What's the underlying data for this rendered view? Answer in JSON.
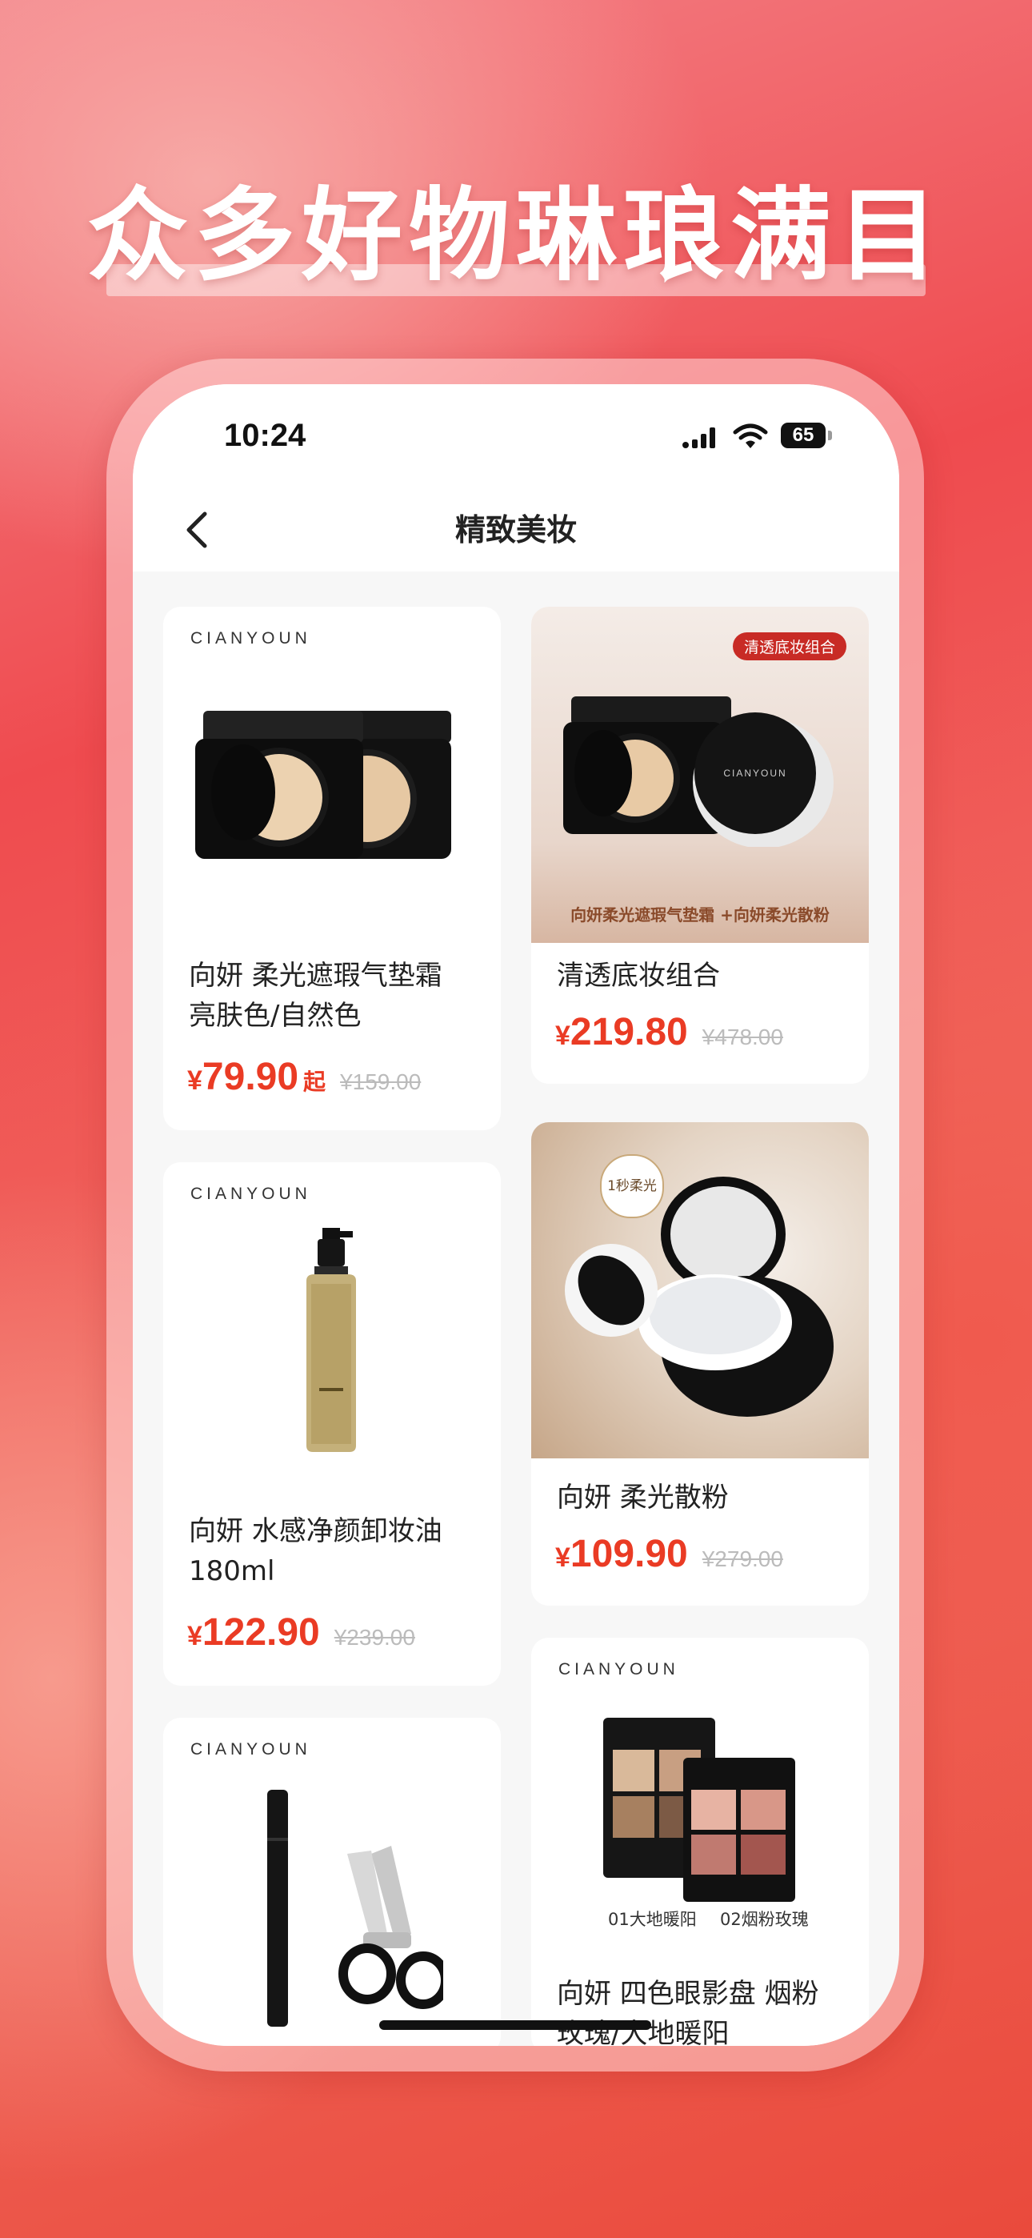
{
  "headline": "众多好物琳琅满目",
  "status_bar": {
    "time": "10:24",
    "battery": "65"
  },
  "nav": {
    "title": "精致美妆"
  },
  "products": [
    {
      "brand": "CIANYOUN",
      "title_line1": "向妍 柔光遮瑕气垫霜",
      "title_line2": "亮肤色/自然色",
      "price": "79.90",
      "price_suffix": "起",
      "original_price": "¥159.00"
    },
    {
      "tag": "清透底妆组合",
      "caption": "向妍柔光遮瑕气垫霜 +向妍柔光散粉",
      "title_line1": "清透底妆组合",
      "price": "219.80",
      "original_price": "¥478.00"
    },
    {
      "brand": "CIANYOUN",
      "title_line1": "向妍 水感净颜卸妆油",
      "title_line2": "180ml",
      "price": "122.90",
      "original_price": "¥239.00"
    },
    {
      "badge": "1秒柔光",
      "title_line1": "向妍 柔光散粉",
      "price": "109.90",
      "original_price": "¥279.00"
    },
    {
      "brand": "CIANYOUN"
    },
    {
      "brand": "CIANYOUN",
      "swatch_1": "01大地暖阳",
      "swatch_2": "02烟粉玫瑰",
      "title_line1": "向妍 四色眼影盘 烟粉",
      "title_line2": "玫瑰/大地暖阳"
    }
  ],
  "currency": "¥",
  "colors": {
    "accent": "#ea3b24",
    "tag": "#c82b25"
  },
  "icons": {
    "back": "chevron-left-icon",
    "signal": "cellular-signal-icon",
    "wifi": "wifi-icon",
    "battery": "battery-icon"
  }
}
